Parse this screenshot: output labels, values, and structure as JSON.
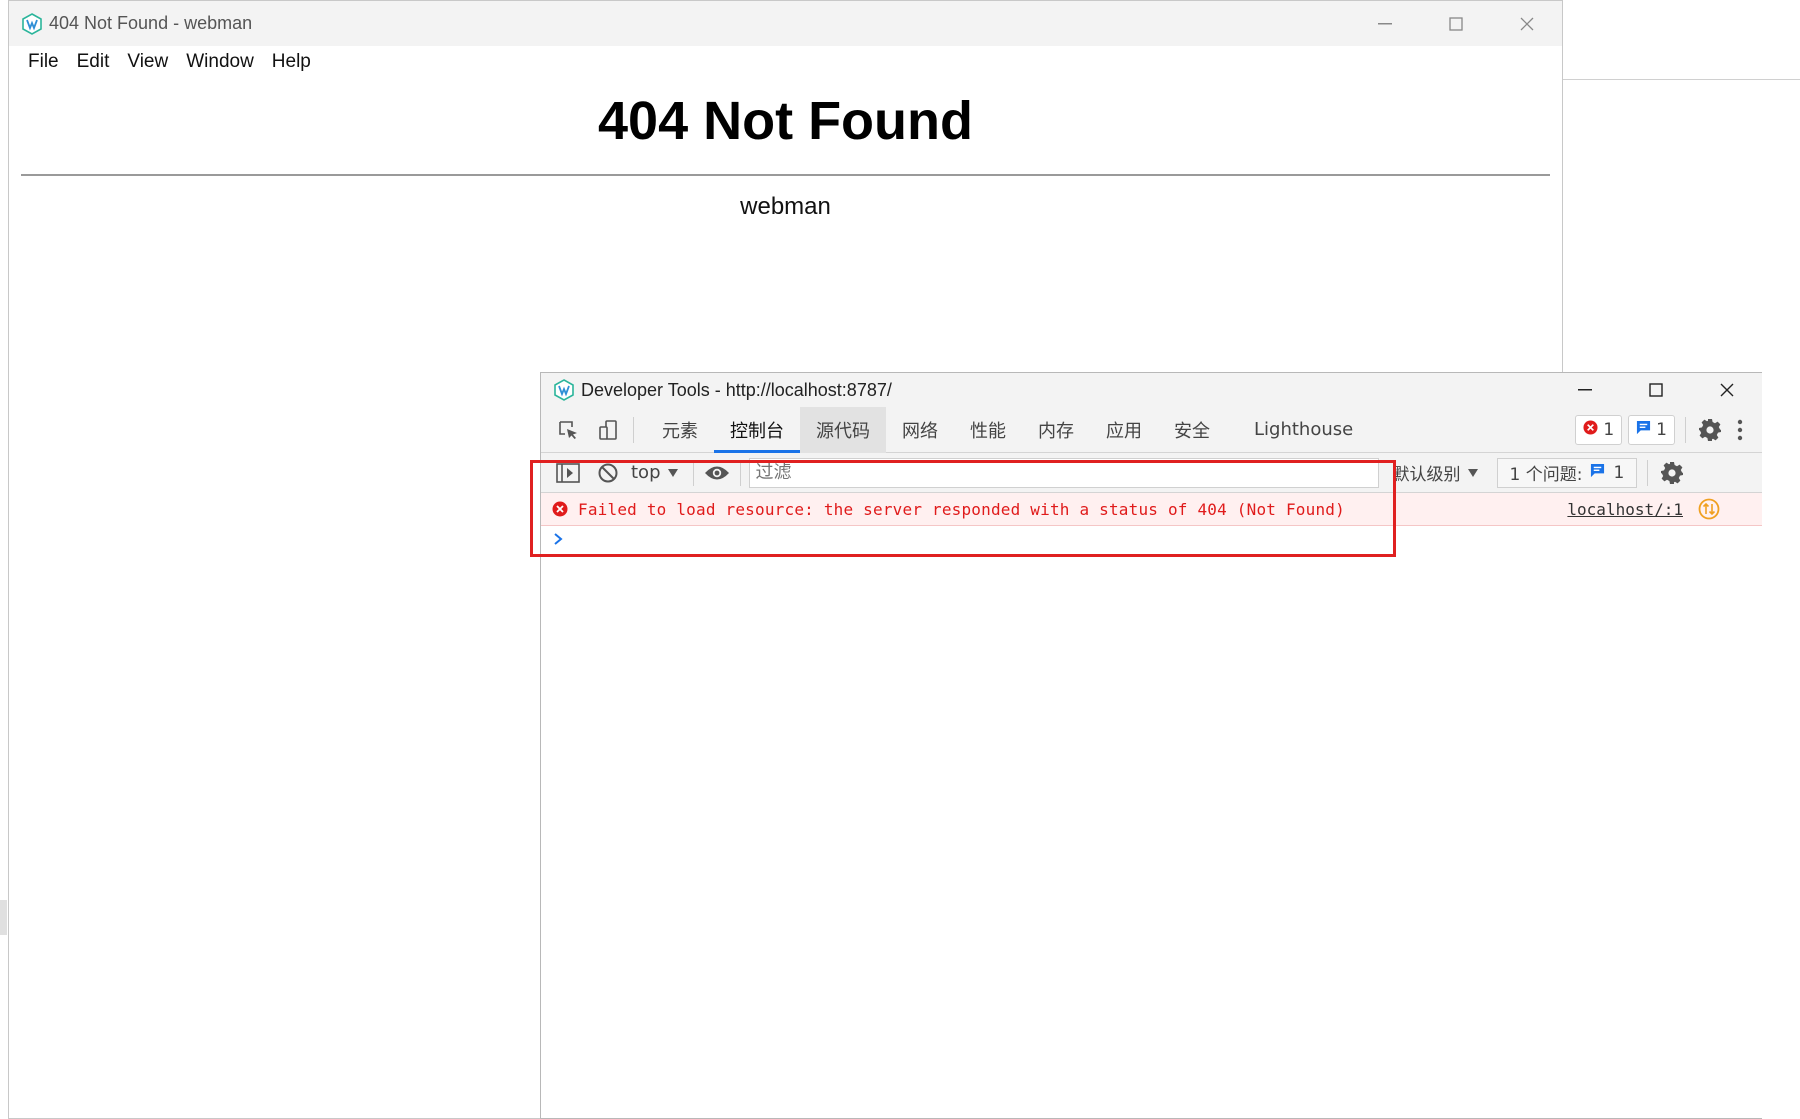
{
  "main_window": {
    "title": "404 Not Found - webman",
    "menu": [
      "File",
      "Edit",
      "View",
      "Window",
      "Help"
    ],
    "heading": "404 Not Found",
    "server_signature": "webman"
  },
  "devtools_window": {
    "title": "Developer Tools - http://localhost:8787/",
    "tabs": [
      "元素",
      "控制台",
      "源代码",
      "网络",
      "性能",
      "内存",
      "应用",
      "安全",
      "Lighthouse"
    ],
    "active_tab": "控制台",
    "error_count": "1",
    "message_count": "1",
    "console_toolbar": {
      "context": "top",
      "filter_placeholder": "过滤",
      "levels": "默认级别",
      "issues_label": "1 个问题:",
      "issues_count": "1"
    },
    "log": {
      "message": "Failed to load resource: the server responded with a status of 404 (Not Found)",
      "source": "localhost/:1"
    }
  },
  "colors": {
    "error_red": "#e01b1b",
    "active_tab_underline": "#1a73e8",
    "annotation_box": "#e02020"
  }
}
